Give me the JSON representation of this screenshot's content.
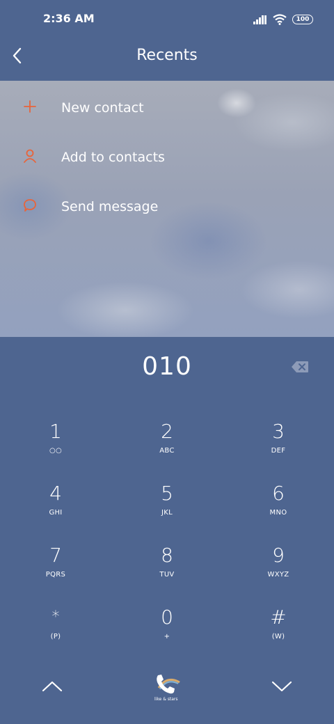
{
  "status": {
    "time": "2:36 AM",
    "battery": "100"
  },
  "header": {
    "title": "Recents"
  },
  "options": [
    {
      "label": "New contact",
      "icon": "plus-icon"
    },
    {
      "label": "Add to contacts",
      "icon": "person-icon"
    },
    {
      "label": "Send message",
      "icon": "chat-bubble-icon"
    }
  ],
  "dialer": {
    "number": "010",
    "keys": [
      {
        "digit": "1",
        "sub": "○○"
      },
      {
        "digit": "2",
        "sub": "ABC"
      },
      {
        "digit": "3",
        "sub": "DEF"
      },
      {
        "digit": "4",
        "sub": "GHI"
      },
      {
        "digit": "5",
        "sub": "JKL"
      },
      {
        "digit": "6",
        "sub": "MNO"
      },
      {
        "digit": "7",
        "sub": "PQRS"
      },
      {
        "digit": "8",
        "sub": "TUV"
      },
      {
        "digit": "9",
        "sub": "WXYZ"
      },
      {
        "digit": "*",
        "sub": "(P)"
      },
      {
        "digit": "0",
        "sub": "+"
      },
      {
        "digit": "#",
        "sub": "(W)"
      }
    ]
  },
  "bottom": {
    "call_caption": "like & stars"
  },
  "colors": {
    "background": "#4e6590",
    "accent": "#e8643a",
    "text": "#ffffff"
  }
}
